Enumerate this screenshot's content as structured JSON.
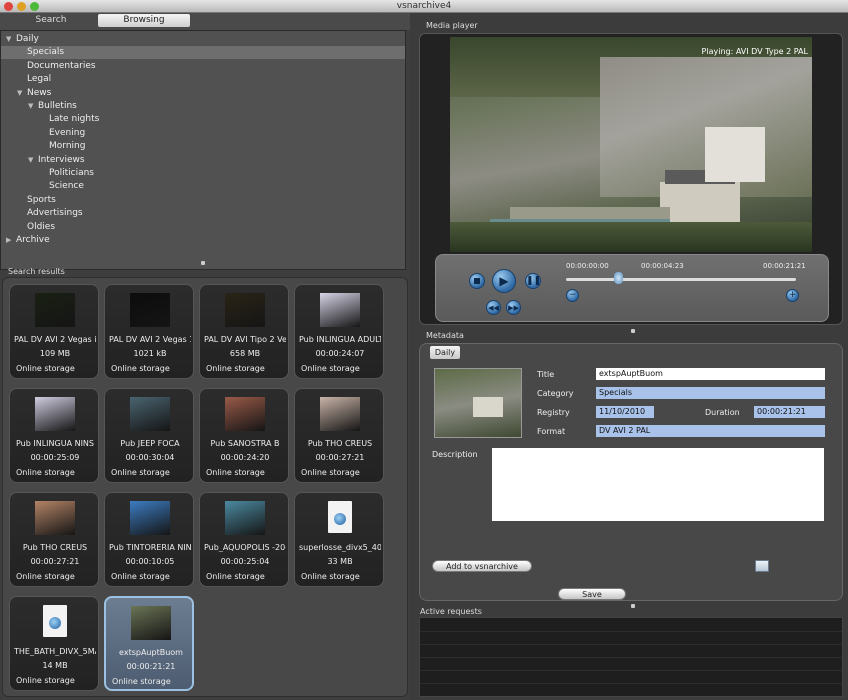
{
  "window": {
    "title": "vsnarchive4"
  },
  "left": {
    "tabs": {
      "search": "Search",
      "browsing": "Browsing"
    },
    "tree": [
      {
        "label": "Daily",
        "indent": 0,
        "expanded": true
      },
      {
        "label": "Specials",
        "indent": 1,
        "selected": true
      },
      {
        "label": "Documentaries",
        "indent": 1
      },
      {
        "label": "Legal",
        "indent": 1
      },
      {
        "label": "News",
        "indent": 1,
        "expanded": true
      },
      {
        "label": "Bulletins",
        "indent": 2,
        "expanded": true
      },
      {
        "label": "Late nights",
        "indent": 3
      },
      {
        "label": "Evening",
        "indent": 3
      },
      {
        "label": "Morning",
        "indent": 3
      },
      {
        "label": "Interviews",
        "indent": 2,
        "expanded": true
      },
      {
        "label": "Politicians",
        "indent": 3
      },
      {
        "label": "Science",
        "indent": 3
      },
      {
        "label": "Sports",
        "indent": 1
      },
      {
        "label": "Advertisings",
        "indent": 1
      },
      {
        "label": "Oldies",
        "indent": 1
      },
      {
        "label": "Archive",
        "indent": 0,
        "collapsed": true
      }
    ],
    "results_label": "Search results",
    "results": [
      {
        "name": "PAL DV AVI 2 Vegas i",
        "info": "109 MB",
        "storage": "Online storage",
        "thumb": "#1a2014"
      },
      {
        "name": "PAL DV AVI 2 Vegas 1",
        "info": "1021 kB",
        "storage": "Online storage",
        "thumb": "#0c0c0c"
      },
      {
        "name": "PAL DV AVI Tipo 2 Ve",
        "info": "658 MB",
        "storage": "Online storage",
        "thumb": "#2a2416"
      },
      {
        "name": "Pub INLINGUA ADULT",
        "info": "00:00:24:07",
        "storage": "Online storage",
        "thumb": "#d7d4e6"
      },
      {
        "name": "Pub INLINGUA NINS",
        "info": "00:00:25:09",
        "storage": "Online storage",
        "thumb": "#cfcde0"
      },
      {
        "name": "Pub JEEP FOCA",
        "info": "00:00:30:04",
        "storage": "Online storage",
        "thumb": "#4a6470"
      },
      {
        "name": "Pub SANOSTRA B",
        "info": "00:00:24:20",
        "storage": "Online storage",
        "thumb": "#9a5a48"
      },
      {
        "name": "Pub THO CREUS",
        "info": "00:00:27:21",
        "storage": "Online storage",
        "thumb": "#c9b4a8"
      },
      {
        "name": "Pub THO CREUS",
        "info": "00:00:27:21",
        "storage": "Online storage",
        "thumb": "#b48466"
      },
      {
        "name": "Pub TINTORERIA NIN",
        "info": "00:00:10:05",
        "storage": "Online storage",
        "thumb": "#3c7cc2"
      },
      {
        "name": "Pub_AQUOPOLIS -20-",
        "info": "00:00:25:04",
        "storage": "Online storage",
        "thumb": "#4b8aa0"
      },
      {
        "name": "superlosse_divx5_40",
        "info": "33 MB",
        "storage": "Online storage",
        "file": true
      },
      {
        "name": "THE_BATH_DIVX_5MA",
        "info": "14 MB",
        "storage": "Online storage",
        "file": true
      },
      {
        "name": "extspAuptBuom",
        "info": "00:00:21:21",
        "storage": "Online storage",
        "thumb": "#6b7455",
        "selected": true
      }
    ]
  },
  "player": {
    "label": "Media player",
    "playing_text": "Playing: AVI DV Type 2 PAL",
    "time_start": "00:00:00:00",
    "time_current": "00:00:04:23",
    "time_end": "00:00:21:21",
    "position_fraction": 0.225
  },
  "metadata": {
    "label": "Metadata",
    "tab": "Daily",
    "title_label": "Title",
    "title_value": "extspAuptBuom",
    "category_label": "Category",
    "category_value": "Specials",
    "registry_label": "Registry",
    "registry_value": "11/10/2010",
    "duration_label": "Duration",
    "duration_value": "00:00:21:21",
    "format_label": "Format",
    "format_value": "DV AVI 2 PAL",
    "description_label": "Description",
    "add_button": "Add to vsnarchive",
    "save_button": "Save"
  },
  "requests": {
    "label": "Active requests"
  }
}
